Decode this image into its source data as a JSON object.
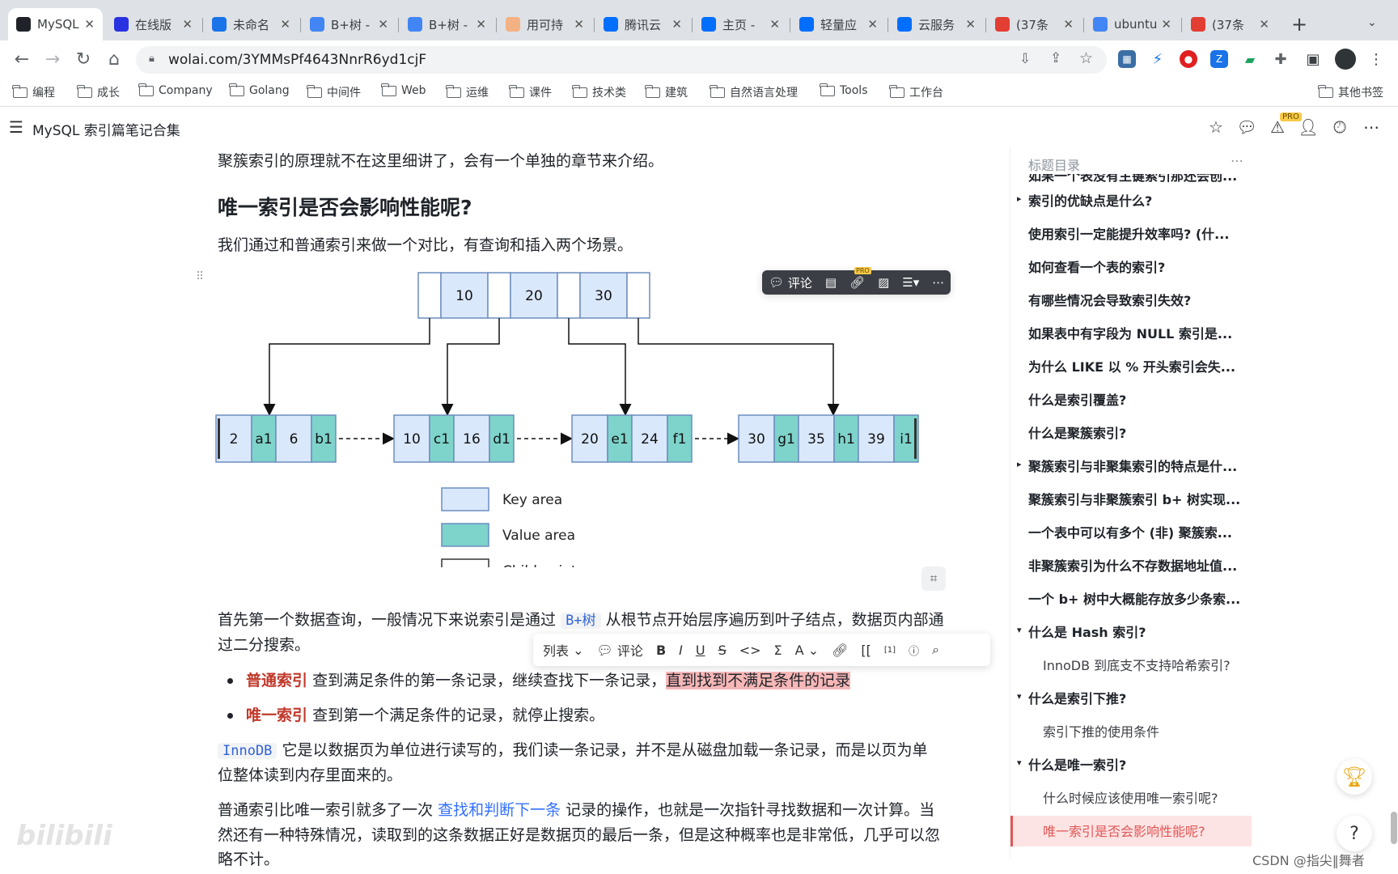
{
  "browser": {
    "tabs": [
      {
        "title": "MySQL",
        "icon": "notion-icon",
        "color": "#1f2329",
        "active": true
      },
      {
        "title": "在线版",
        "icon": "baidu-paw-icon",
        "color": "#2932e1"
      },
      {
        "title": "未命名",
        "icon": "on-icon",
        "color": "#1a73e8"
      },
      {
        "title": "B+树 -",
        "icon": "google-icon",
        "color": "#4285f4"
      },
      {
        "title": "B+树 -",
        "icon": "google-icon",
        "color": "#4285f4"
      },
      {
        "title": "用可持",
        "icon": "avatar-icon",
        "color": "#f4b183"
      },
      {
        "title": "腾讯云",
        "icon": "cloud-icon",
        "color": "#006eff"
      },
      {
        "title": "主页 -",
        "icon": "cloud-icon",
        "color": "#006eff"
      },
      {
        "title": "轻量应",
        "icon": "cloud-icon",
        "color": "#006eff"
      },
      {
        "title": "云服务",
        "icon": "cloud-icon",
        "color": "#006eff"
      },
      {
        "title": "(37条",
        "icon": "csdn-icon",
        "color": "#e33e33"
      },
      {
        "title": "ubuntu",
        "icon": "google-icon",
        "color": "#4285f4"
      },
      {
        "title": "(37条",
        "icon": "csdn-icon",
        "color": "#e33e33"
      }
    ],
    "new_tab": "+",
    "url": "wolai.com/3YMMsPf4643NnrR6yd1cjF",
    "bookmarks": [
      "编程",
      "成长",
      "Company",
      "Golang",
      "中间件",
      "Web",
      "运维",
      "课件",
      "技术类",
      "建筑",
      "自然语言处理",
      "Tools",
      "工作台"
    ],
    "other_bookmarks": "其他书签"
  },
  "app": {
    "title": "MySQL 索引篇笔记合集",
    "pro_badge": "PRO"
  },
  "content": {
    "intro": "聚簇索引的原理就不在这里细讲了，会有一个单独的章节来介绍。",
    "heading": "唯一索引是否会影响性能呢?",
    "lead": "我们通过和普通索引来做一个对比，有查询和插入两个场景。",
    "p1_a": "首先第一个数据查询，一般情况下来说索引是通过",
    "p1_code": "B+树",
    "p1_b": "从根节点开始层序遍历到叶子结点，数据页内部通",
    "p1_c": "过二分搜索。",
    "b1_bold": "普通索引",
    "b1_text": "查到满足条件的第一条记录，继续查找下一条记录，",
    "b1_hl": "直到找到不满足条件的记录",
    "b2_bold": "唯一索引",
    "b2_text": "查到第一个满足条件的记录，就停止搜索。",
    "p2_code": "InnoDB",
    "p2_a": "它是以数据页为单位进行读写的，我们读一条记录，并不是从磁盘加载一条记录，而是以页为单",
    "p2_b": "位整体读到内存里面来的。",
    "p3_a": "普通索引比唯一索引就多了一次",
    "p3_link": "查找和判断下一条",
    "p3_b": "记录的操作，也就是一次指针寻找数据和一次计算。当",
    "p3_c": "然还有一种特殊情况，读取到的这条数据正好是数据页的最后一条，但是这种概率也是非常低，几乎可以忽",
    "p3_d": "略不计。"
  },
  "diagram": {
    "root_keys": [
      "10",
      "20",
      "30"
    ],
    "leaves": [
      {
        "cells": [
          [
            "2",
            "key"
          ],
          [
            "a1",
            "val"
          ],
          [
            "6",
            "key"
          ],
          [
            "b1",
            "val"
          ]
        ]
      },
      {
        "cells": [
          [
            "10",
            "key"
          ],
          [
            "c1",
            "val"
          ],
          [
            "16",
            "key"
          ],
          [
            "d1",
            "val"
          ]
        ]
      },
      {
        "cells": [
          [
            "20",
            "key"
          ],
          [
            "e1",
            "val"
          ],
          [
            "24",
            "key"
          ],
          [
            "f1",
            "val"
          ]
        ]
      },
      {
        "cells": [
          [
            "30",
            "key"
          ],
          [
            "g1",
            "val"
          ],
          [
            "35",
            "key"
          ],
          [
            "h1",
            "val"
          ],
          [
            "39",
            "key"
          ],
          [
            "i1",
            "val"
          ]
        ]
      }
    ],
    "legend": [
      "Key area",
      "Value area",
      "Child pointer"
    ],
    "colors": {
      "key": "#dae8fc",
      "value": "#7ed3cb",
      "pointer": "#ffffff",
      "stroke": "#6c8ebf"
    }
  },
  "block_toolbar": {
    "comment": "评论",
    "pro": "PRO"
  },
  "text_toolbar": {
    "list": "列表",
    "comment": "评论",
    "bold": "B",
    "italic": "I",
    "underline": "U",
    "strike": "S",
    "code": "<>",
    "sigma": "Σ",
    "font": "A",
    "bracket": "[[",
    "sup": "[1]"
  },
  "toc": {
    "title": "标题目录",
    "clipped": "如果一个表没有主键索引那还会创...",
    "items": [
      {
        "text": "索引的优缺点是什么?",
        "level": 1,
        "tri": "▸"
      },
      {
        "text": "使用索引一定能提升效率吗? (什...",
        "level": 1
      },
      {
        "text": "如何查看一个表的索引?",
        "level": 1
      },
      {
        "text": "有哪些情况会导致索引失效?",
        "level": 1
      },
      {
        "text": "如果表中有字段为 NULL 索引是...",
        "level": 1
      },
      {
        "text": "为什么 LIKE 以 % 开头索引会失...",
        "level": 1
      },
      {
        "text": "什么是索引覆盖?",
        "level": 1
      },
      {
        "text": "什么是聚簇索引?",
        "level": 1
      },
      {
        "text": "聚簇索引与非聚集索引的特点是什...",
        "level": 1,
        "tri": "▸"
      },
      {
        "text": "聚簇索引与非聚簇索引 b+ 树实现...",
        "level": 1
      },
      {
        "text": "一个表中可以有多个 (非) 聚簇索...",
        "level": 1
      },
      {
        "text": "非聚簇索引为什么不存数据地址值...",
        "level": 1
      },
      {
        "text": "一个 b+ 树中大概能存放多少条索...",
        "level": 1
      },
      {
        "text": "什么是 Hash 索引?",
        "level": 1,
        "tri": "▾"
      },
      {
        "text": "InnoDB 到底支不支持哈希索引?",
        "level": 2
      },
      {
        "text": "什么是索引下推?",
        "level": 1,
        "tri": "▾"
      },
      {
        "text": "索引下推的使用条件",
        "level": 2
      },
      {
        "text": "什么是唯一索引?",
        "level": 1,
        "tri": "▾"
      },
      {
        "text": "什么时候应该使用唯一索引呢?",
        "level": 2
      },
      {
        "text": "唯一索引是否会影响性能呢?",
        "level": 2,
        "active": true
      }
    ]
  },
  "watermarks": {
    "csdn": "CSDN @指尖‖舞者",
    "bili": "bilibili"
  },
  "help": "?"
}
